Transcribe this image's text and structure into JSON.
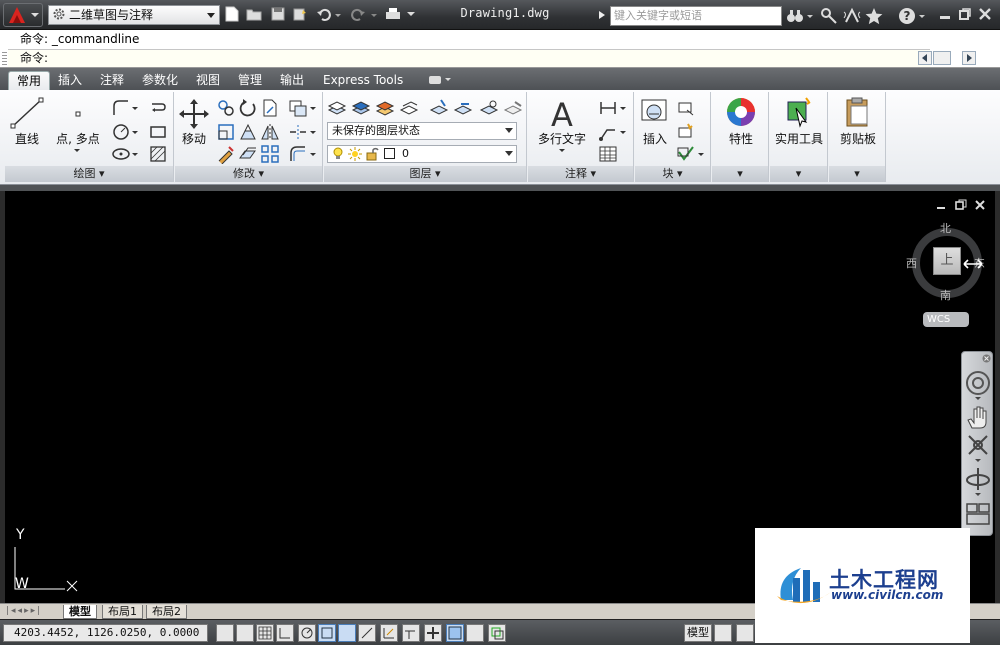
{
  "window": {
    "workspace": "二维草图与注释",
    "doc_title": "Drawing1.dwg",
    "search_placeholder": "键入关键字或短语"
  },
  "command": {
    "history_line": "命令: _commandline",
    "prompt": "命令:"
  },
  "ribbon": {
    "tabs": [
      "常用",
      "插入",
      "注释",
      "参数化",
      "视图",
      "管理",
      "输出",
      "Express Tools"
    ],
    "active_tab": "常用",
    "panels": {
      "draw": {
        "title": "绘图",
        "line": "直线",
        "point": "点, 多点"
      },
      "modify": {
        "title": "修改",
        "move": "移动"
      },
      "layers": {
        "title": "图层",
        "state": "未保存的图层状态",
        "current_layer": "0"
      },
      "annotate": {
        "title": "注释",
        "mtext": "多行文字"
      },
      "block": {
        "title": "块",
        "insert": "插入"
      },
      "properties": {
        "label": "特性"
      },
      "utilities": {
        "label": "实用工具"
      },
      "clipboard": {
        "label": "剪贴板"
      }
    }
  },
  "viewcube": {
    "north": "北",
    "south": "南",
    "east": "东",
    "west": "西",
    "face": "上",
    "wcs": "WCS"
  },
  "ucs": {
    "y": "Y",
    "w": "W"
  },
  "layout_tabs": [
    "模型",
    "布局1",
    "布局2"
  ],
  "status": {
    "coords": "4203.4452,  1126.0250,  0.0000",
    "model": "模型"
  },
  "watermark": {
    "title": "土木工程网",
    "url": "www.civilcn.com"
  },
  "colors": {
    "accent": "#e21b1b",
    "canvas": "#000000",
    "ribbon": "#eef0f3"
  }
}
